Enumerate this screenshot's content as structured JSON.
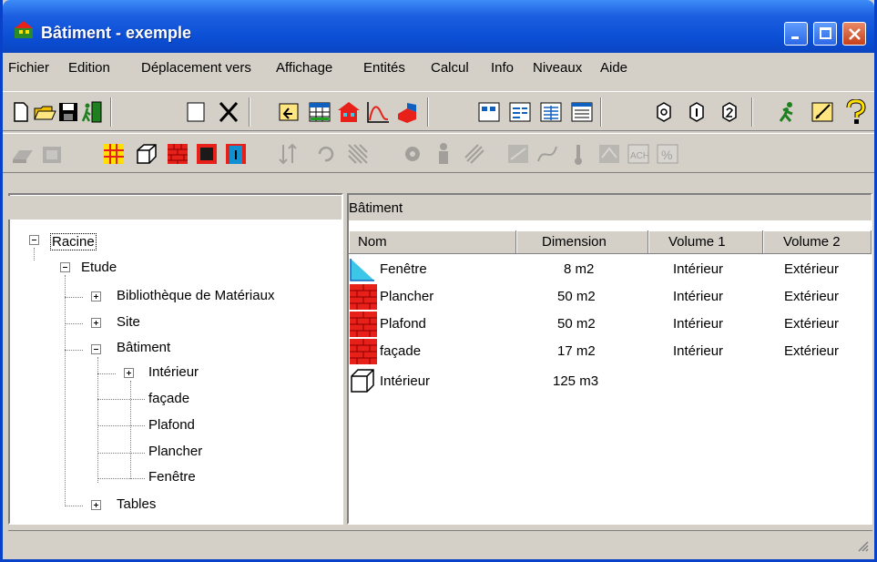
{
  "window": {
    "title": "Bâtiment - exemple",
    "controls": [
      "minimize",
      "maximize",
      "close"
    ]
  },
  "menu": [
    "Fichier",
    "Edition",
    "Déplacement vers",
    "Affichage",
    "Entités",
    "Calcul",
    "Info",
    "Niveaux",
    "Aide"
  ],
  "toolbar1": {
    "icons": [
      "new-file-icon",
      "open-folder-icon",
      "save-icon",
      "exit-icon",
      "new-element-icon",
      "delete-icon",
      "import-icon",
      "table-icon",
      "building-icon",
      "graph-icon",
      "layer-icon",
      "view-small-icon",
      "view-list-icon",
      "view-details-icon",
      "view-table-icon",
      "level-0-icon",
      "level-1-icon",
      "level-2-icon",
      "run-icon",
      "edit-icon",
      "help-icon"
    ]
  },
  "toolbar2": {
    "icons": [
      "wall-icon",
      "window-element-icon",
      "grid-icon",
      "cube-icon",
      "brick-icon",
      "material-icon",
      "door-icon",
      "sort-icon",
      "rotate-icon",
      "pattern-icon",
      "gear-icon",
      "person-icon",
      "chemical-icon",
      "compare-icon",
      "curve-icon",
      "thermometer-icon",
      "balance-icon",
      "ach-icon",
      "percent-icon"
    ]
  },
  "left_pane": {
    "tree": [
      {
        "label": "Racine",
        "expanded": true,
        "selected": true
      },
      {
        "label": "Etude",
        "expanded": true
      },
      {
        "label": "Bibliothèque de Matériaux",
        "expanded": false
      },
      {
        "label": "Site",
        "expanded": false
      },
      {
        "label": "Bâtiment",
        "expanded": true
      },
      {
        "label": "Intérieur",
        "expanded": false
      },
      {
        "label": "façade"
      },
      {
        "label": "Plafond"
      },
      {
        "label": "Plancher"
      },
      {
        "label": "Fenêtre"
      },
      {
        "label": "Tables",
        "expanded": false
      }
    ]
  },
  "right_pane": {
    "title": "Bâtiment",
    "columns": [
      "Nom",
      "Dimension",
      "Volume 1",
      "Volume 2"
    ],
    "rows": [
      {
        "icon": "window-icon",
        "nom": "Fenêtre",
        "dimension": "8 m2",
        "volume1": "Intérieur",
        "volume2": "Extérieur"
      },
      {
        "icon": "brick-wall-icon",
        "nom": "Plancher",
        "dimension": "50 m2",
        "volume1": "Intérieur",
        "volume2": "Extérieur"
      },
      {
        "icon": "brick-wall-icon",
        "nom": "Plafond",
        "dimension": "50 m2",
        "volume1": "Intérieur",
        "volume2": "Extérieur"
      },
      {
        "icon": "brick-wall-icon",
        "nom": "façade",
        "dimension": "17 m2",
        "volume1": "Intérieur",
        "volume2": "Extérieur"
      },
      {
        "icon": "cube-icon",
        "nom": "Intérieur",
        "dimension": "125 m3",
        "volume1": "",
        "volume2": ""
      }
    ]
  },
  "colors": {
    "titlebar": "#0b4fd6",
    "chrome": "#d4d0c8",
    "brick": "#e8201a",
    "window_glass": "#3cc6e8"
  }
}
